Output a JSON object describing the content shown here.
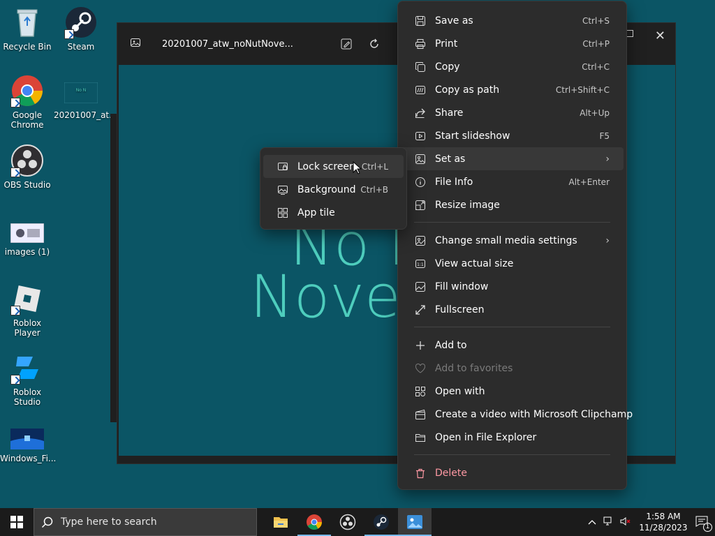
{
  "desktop": {
    "icons": [
      {
        "label": "Recycle Bin"
      },
      {
        "label": "Steam"
      },
      {
        "label": "Google Chrome"
      },
      {
        "label": "20201007_at..."
      },
      {
        "label": "OBS Studio"
      },
      {
        "label": "images (1)"
      },
      {
        "label": "Roblox Player"
      },
      {
        "label": "Roblox Studio"
      },
      {
        "label": "Windows_Fi..."
      }
    ]
  },
  "photos": {
    "title": "20201007_atw_noNutNove...",
    "image_text": [
      "No N",
      "Nove"
    ]
  },
  "context_menu": {
    "items": [
      {
        "label": "Save as",
        "shortcut": "Ctrl+S",
        "icon": "save-icon"
      },
      {
        "label": "Print",
        "shortcut": "Ctrl+P",
        "icon": "print-icon"
      },
      {
        "label": "Copy",
        "shortcut": "Ctrl+C",
        "icon": "copy-icon"
      },
      {
        "label": "Copy as path",
        "shortcut": "Ctrl+Shift+C",
        "icon": "copy-path-icon"
      },
      {
        "label": "Share",
        "shortcut": "Alt+Up",
        "icon": "share-icon"
      },
      {
        "label": "Start slideshow",
        "shortcut": "F5",
        "icon": "slideshow-icon"
      },
      {
        "label": "Set as",
        "shortcut": "",
        "icon": "set-as-icon"
      },
      {
        "label": "File Info",
        "shortcut": "Alt+Enter",
        "icon": "info-icon"
      },
      {
        "label": "Resize image",
        "shortcut": "",
        "icon": "resize-icon"
      },
      {
        "label": "Change small media settings",
        "shortcut": "",
        "icon": "media-settings-icon"
      },
      {
        "label": "View actual size",
        "shortcut": "",
        "icon": "actual-size-icon"
      },
      {
        "label": "Fill window",
        "shortcut": "",
        "icon": "fill-window-icon"
      },
      {
        "label": "Fullscreen",
        "shortcut": "",
        "icon": "fullscreen-icon"
      },
      {
        "label": "Add to",
        "shortcut": "",
        "icon": "plus-icon"
      },
      {
        "label": "Add to favorites",
        "shortcut": "",
        "icon": "heart-icon"
      },
      {
        "label": "Open with",
        "shortcut": "",
        "icon": "open-with-icon"
      },
      {
        "label": "Create a video with Microsoft Clipchamp",
        "shortcut": "",
        "icon": "clipchamp-icon"
      },
      {
        "label": "Open in File Explorer",
        "shortcut": "",
        "icon": "folder-icon"
      },
      {
        "label": "Delete",
        "shortcut": "",
        "icon": "trash-icon"
      }
    ]
  },
  "submenu": {
    "items": [
      {
        "label": "Lock screen",
        "shortcut": "Ctrl+L",
        "icon": "lock-screen-icon"
      },
      {
        "label": "Background",
        "shortcut": "Ctrl+B",
        "icon": "background-icon"
      },
      {
        "label": "App tile",
        "shortcut": "",
        "icon": "app-tile-icon"
      }
    ]
  },
  "taskbar": {
    "search_placeholder": "Type here to search",
    "time": "1:58 AM",
    "date": "11/28/2023",
    "notification_count": "1"
  },
  "colors": {
    "desktop_bg": "#0b5565",
    "menu_bg": "#2c2c2c",
    "danger": "#ff99a4",
    "image_text": "#4ecdbd",
    "taskbar_bg": "#1b1b1b"
  }
}
